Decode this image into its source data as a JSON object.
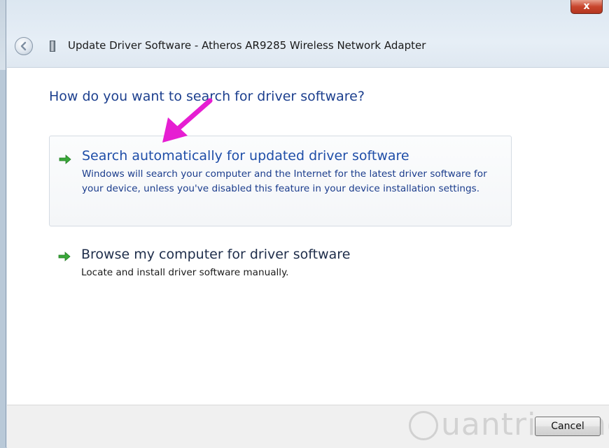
{
  "window": {
    "title": "Update Driver Software - Atheros AR9285 Wireless Network Adapter",
    "close_label": "x"
  },
  "content": {
    "question": "How do you want to search for driver software?",
    "options": [
      {
        "title": "Search automatically for updated driver software",
        "description": "Windows will search your computer and the Internet for the latest driver software for your device, unless you've disabled this feature in your device installation settings."
      },
      {
        "title": "Browse my computer for driver software",
        "description": "Locate and install driver software manually."
      }
    ]
  },
  "footer": {
    "cancel_label": "Cancel",
    "watermark": "uantrimang"
  },
  "icons": {
    "back": "back-arrow-icon",
    "device": "device-icon",
    "option_arrow": "green-arrow-icon",
    "annotation": "pink-arrow-icon"
  },
  "colors": {
    "heading": "#1c3f8e",
    "link": "#1f4ea8",
    "arrow_green": "#3aa83a",
    "annotation": "#e61ed2",
    "close": "#c8452d"
  }
}
